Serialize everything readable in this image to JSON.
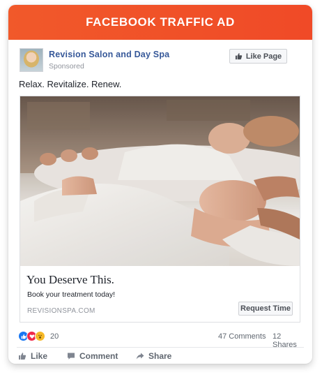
{
  "banner": {
    "title": "FACEBOOK TRAFFIC AD"
  },
  "post": {
    "page_name": "Revision Salon and Day Spa",
    "sponsored_label": "Sponsored",
    "like_page_label": "Like Page",
    "text": "Relax. Revitalize. Renew."
  },
  "ad": {
    "headline": "You Deserve This.",
    "description": "Book your treatment today!",
    "domain": "REVISIONSPA.COM",
    "cta_label": "Request Time"
  },
  "engagement": {
    "reaction_icons": [
      "like-icon",
      "love-icon",
      "wow-icon"
    ],
    "reaction_count": "20",
    "comments": "47 Comments",
    "shares": "12 Shares"
  },
  "actions": {
    "like": "Like",
    "comment": "Comment",
    "share": "Share"
  },
  "colors": {
    "banner": "#f1592a",
    "link_blue": "#365899",
    "like_blue": "#1877f2",
    "love_red": "#f02849",
    "wow_yellow": "#f7b928"
  }
}
